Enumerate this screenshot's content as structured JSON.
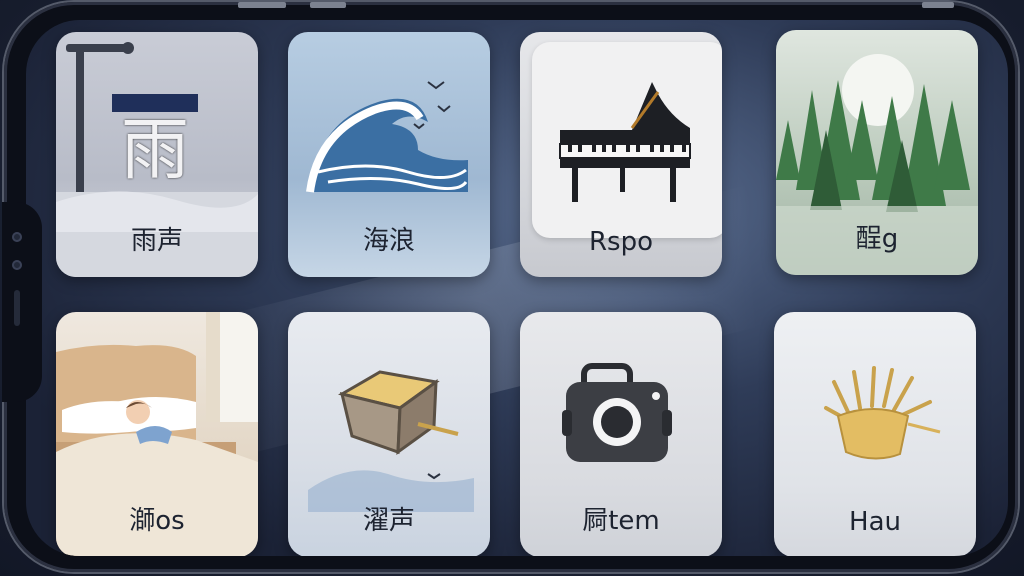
{
  "tiles": [
    {
      "label": "雨声",
      "icon": "rain-icon"
    },
    {
      "label": "海浪",
      "icon": "ocean-wave-icon"
    },
    {
      "label": "Rspo",
      "icon": "grand-piano-icon"
    },
    {
      "label": "酲g",
      "icon": "forest-icon"
    },
    {
      "label": "溮os",
      "icon": "bedroom-icon"
    },
    {
      "label": "濯声",
      "icon": "box-icon"
    },
    {
      "label": "屙tem",
      "icon": "camera-icon"
    },
    {
      "label": "Hau",
      "icon": "bundle-icon"
    }
  ],
  "rain_glyph": "雨",
  "colors": {
    "screen": "#2f3c58",
    "label": "#1d2330"
  }
}
